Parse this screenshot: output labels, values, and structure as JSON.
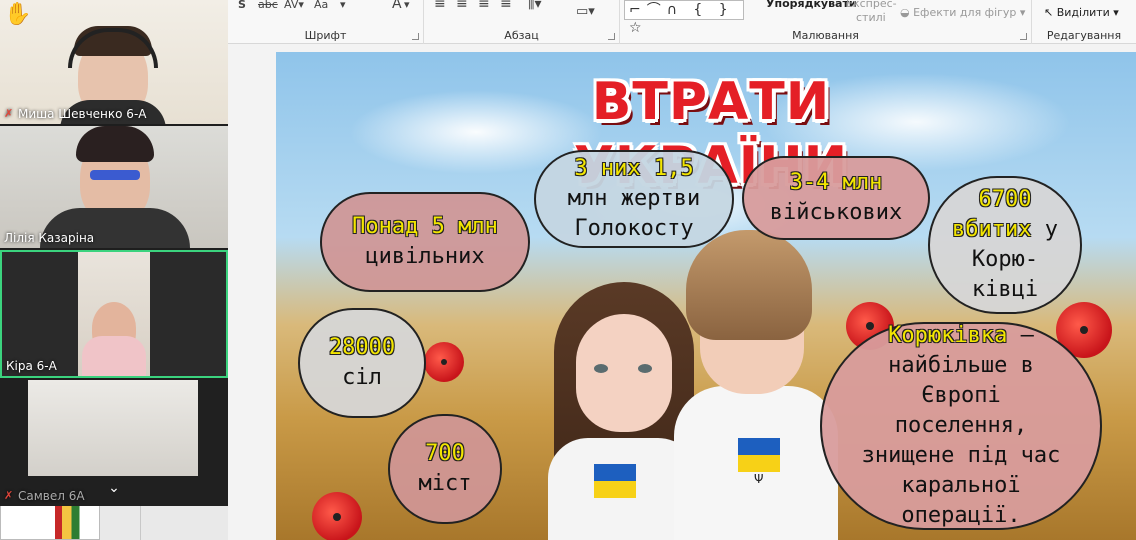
{
  "ribbon": {
    "groups": [
      {
        "label": "Шрифт"
      },
      {
        "label": "Абзац"
      },
      {
        "label": "Малювання"
      },
      {
        "label": "Редагування"
      }
    ],
    "arrange_label": "Упорядкувати",
    "express_label_1": "Експрес-",
    "express_label_2": "стилі",
    "shape_effects_label": "Ефекти для фігур",
    "select_label": "Виділити",
    "font_aa": "Aa",
    "font_a": "A",
    "strike": "abc",
    "shapes_glyphs": "⌐⌒∩ { } ☆"
  },
  "participants": [
    {
      "name": "Миша Шевченко 6-А",
      "muted": true,
      "hand_raised": true
    },
    {
      "name": "Лілія Казаріна",
      "muted": false
    },
    {
      "name": "Кіра 6-А",
      "muted": false,
      "active": true
    },
    {
      "name": "Самвел 6А",
      "muted": true
    }
  ],
  "slide": {
    "title": "ВТРАТИ УКРАЇНИ",
    "b1": {
      "y": "Понад 5 млн",
      "t": "цивільних"
    },
    "b2": {
      "y": "3 них 1,5",
      "t": "млн жертви Голокосту"
    },
    "b3": {
      "y": "3-4 млн",
      "t": "військових"
    },
    "b4": {
      "y": "6700 вбитих",
      "t": "у Корю-ківці"
    },
    "b5": {
      "y": "28000",
      "t": "сіл"
    },
    "b6": {
      "y": "700",
      "t": "міст"
    },
    "b7": {
      "y": "Корюківка",
      "t": "– найбільше в Європі поселення, знищене під час каральної операції."
    }
  }
}
